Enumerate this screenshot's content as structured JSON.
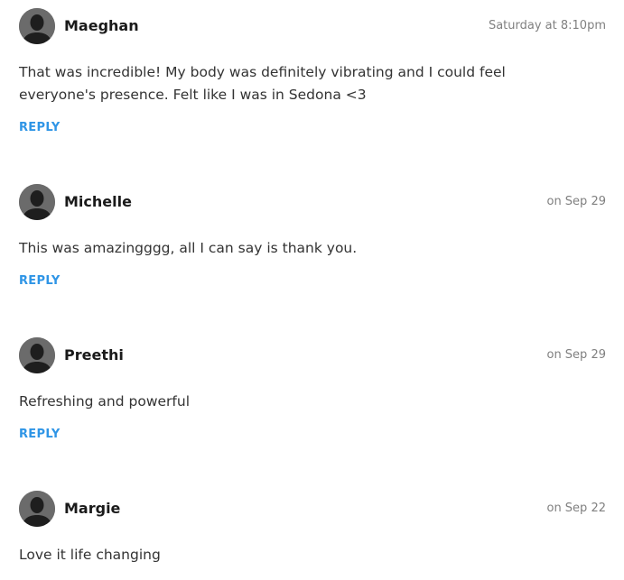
{
  "comments": [
    {
      "author": "Maeghan",
      "timestamp": "Saturday at 8:10pm",
      "text": "That was incredible! My body was definitely vibrating and I could feel everyone's presence. Felt like I was in Sedona <3",
      "reply_label": "REPLY",
      "avatar_icon": "person-silhouette-icon"
    },
    {
      "author": "Michelle",
      "timestamp": "on Sep 29",
      "text": "This was amazingggg, all I can say is thank you.",
      "reply_label": "REPLY",
      "avatar_icon": "person-silhouette-icon"
    },
    {
      "author": "Preethi",
      "timestamp": "on Sep 29",
      "text": "Refreshing and powerful",
      "reply_label": "REPLY",
      "avatar_icon": "person-silhouette-icon"
    },
    {
      "author": "Margie",
      "timestamp": "on Sep 22",
      "text": "Love it life changing",
      "avatar_icon": "person-silhouette-icon"
    }
  ],
  "colors": {
    "reply_link": "#2f95e6",
    "timestamp": "#808080",
    "author": "#1a1a1a",
    "body_text": "#333333",
    "avatar_bg": "#6b6b6b",
    "avatar_figure": "#1e1e1e"
  }
}
